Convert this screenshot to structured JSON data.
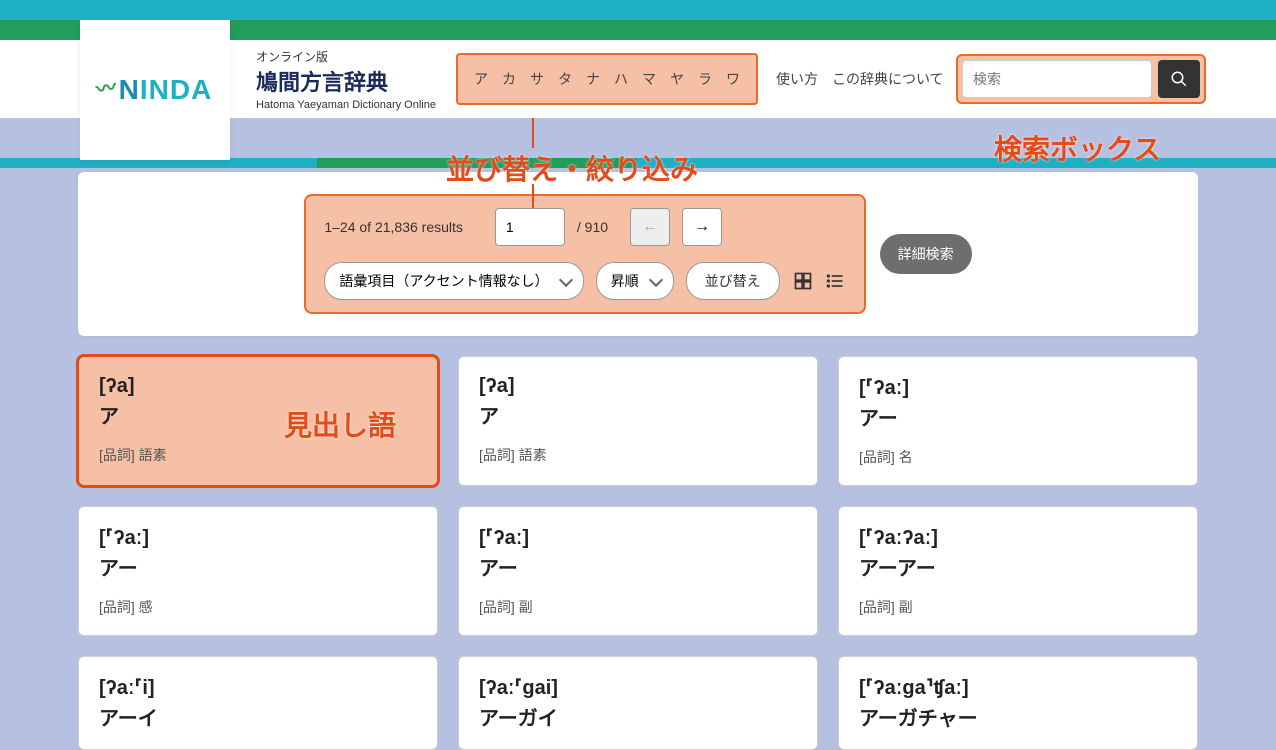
{
  "brand": {
    "logo_text": "NINDA",
    "leaf": "〜"
  },
  "site_title": {
    "sub": "オンライン版",
    "main": "鳩間方言辞典",
    "en": "Hatoma Yaeyaman Dictionary Online"
  },
  "kana_nav": [
    "ア",
    "カ",
    "サ",
    "タ",
    "ナ",
    "ハ",
    "マ",
    "ヤ",
    "ラ",
    "ワ"
  ],
  "nav_links": {
    "usage": "使い方",
    "about": "この辞典について"
  },
  "search": {
    "placeholder": "検索"
  },
  "callouts": {
    "sort": "並び替え・絞り込み",
    "search": "検索ボックス",
    "entry": "見出し語"
  },
  "pagination": {
    "results_text": "1–24 of 21,836 results",
    "current_page": "1",
    "total_pages": "/ 910"
  },
  "sort": {
    "field": "語彙項目（アクセント情報なし）",
    "order": "昇順",
    "apply": "並び替え"
  },
  "advanced_search": "詳細検索",
  "pos_label": "[品詞]",
  "entries": [
    {
      "ipa": "[ʔa]",
      "kana": "ア",
      "pos": "語素"
    },
    {
      "ipa": "[ʔa]",
      "kana": "ア",
      "pos": "語素"
    },
    {
      "ipa": "[⸢ʔaː]",
      "kana": "アー",
      "pos": "名"
    },
    {
      "ipa": "[⸢ʔaː]",
      "kana": "アー",
      "pos": "感"
    },
    {
      "ipa": "[⸢ʔaː]",
      "kana": "アー",
      "pos": "副"
    },
    {
      "ipa": "[⸢ʔaːʔaː]",
      "kana": "アーアー",
      "pos": "副"
    },
    {
      "ipa": "[ʔaː⸢i]",
      "kana": "アーイ",
      "pos": ""
    },
    {
      "ipa": "[ʔaː⸢gai]",
      "kana": "アーガイ",
      "pos": ""
    },
    {
      "ipa": "[⸢ʔaːga⸣ʧaː]",
      "kana": "アーガチャー",
      "pos": ""
    }
  ]
}
